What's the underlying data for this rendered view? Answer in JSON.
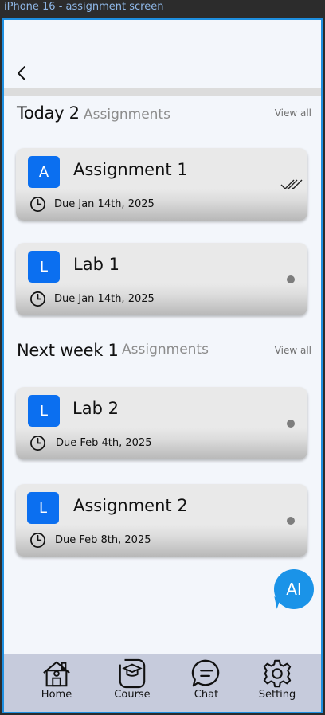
{
  "frame": {
    "label": "iPhone 16 - assignment screen"
  },
  "colors": {
    "accent": "#0b6ff0",
    "ai": "#1a93e8",
    "navbar": "#c6cbdc",
    "frame_border": "#1e8fe0"
  },
  "sections": [
    {
      "title": "Today 2",
      "subtitle": "Assignments",
      "view_all": "View all",
      "items": [
        {
          "badge": "A",
          "title": "Assignment 1",
          "due": "Due Jan 14th, 2025",
          "status": "double-check-icon"
        },
        {
          "badge": "L",
          "title": "Lab 1",
          "due": "Due Jan 14th, 2025",
          "status": "dot"
        }
      ]
    },
    {
      "title": "Next week 1",
      "subtitle": "Assignments",
      "view_all": "View all",
      "items": [
        {
          "badge": "L",
          "title": "Lab 2",
          "due": "Due Feb 4th, 2025",
          "status": "dot"
        },
        {
          "badge": "L",
          "title": "Assignment 2",
          "due": "Due Feb 8th, 2025",
          "status": "dot"
        }
      ]
    }
  ],
  "ai_button": {
    "label": "AI"
  },
  "nav": [
    {
      "label": "Home",
      "icon": "home-icon"
    },
    {
      "label": "Course",
      "icon": "course-icon"
    },
    {
      "label": "Chat",
      "icon": "chat-icon"
    },
    {
      "label": "Setting",
      "icon": "gear-icon"
    }
  ]
}
